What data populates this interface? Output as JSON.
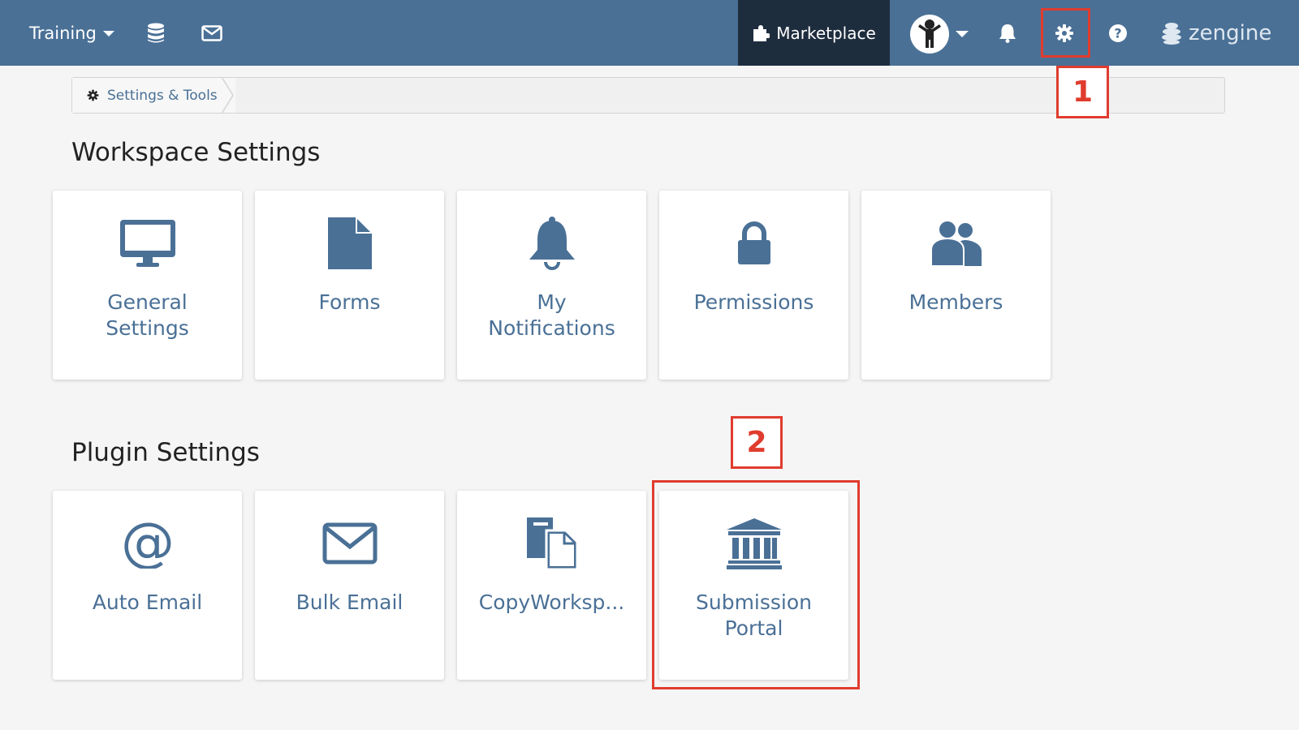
{
  "topbar": {
    "workspace": "Training",
    "marketplace_label": "Marketplace",
    "brand": "zengine"
  },
  "breadcrumb": {
    "label": "Settings & Tools"
  },
  "workspace_settings": {
    "title": "Workspace Settings",
    "tiles": [
      {
        "label": "General Settings",
        "icon": "monitor-icon"
      },
      {
        "label": "Forms",
        "icon": "file-icon"
      },
      {
        "label": "My Notifications",
        "icon": "bell-icon"
      },
      {
        "label": "Permissions",
        "icon": "lock-icon"
      },
      {
        "label": "Members",
        "icon": "users-icon"
      }
    ]
  },
  "plugin_settings": {
    "title": "Plugin Settings",
    "tiles": [
      {
        "label": "Auto Email",
        "icon": "at-icon"
      },
      {
        "label": "Bulk Email",
        "icon": "envelope-icon"
      },
      {
        "label": "CopyWorksp...",
        "icon": "copy-icon"
      },
      {
        "label": "Submission Portal",
        "icon": "institution-icon"
      }
    ]
  },
  "annotations": {
    "step1": "1",
    "step2": "2",
    "color": "#e03c2e"
  },
  "colors": {
    "nav_bg": "#4a7096",
    "marketplace_bg": "#1e2d3e",
    "accent": "#4a7096"
  }
}
